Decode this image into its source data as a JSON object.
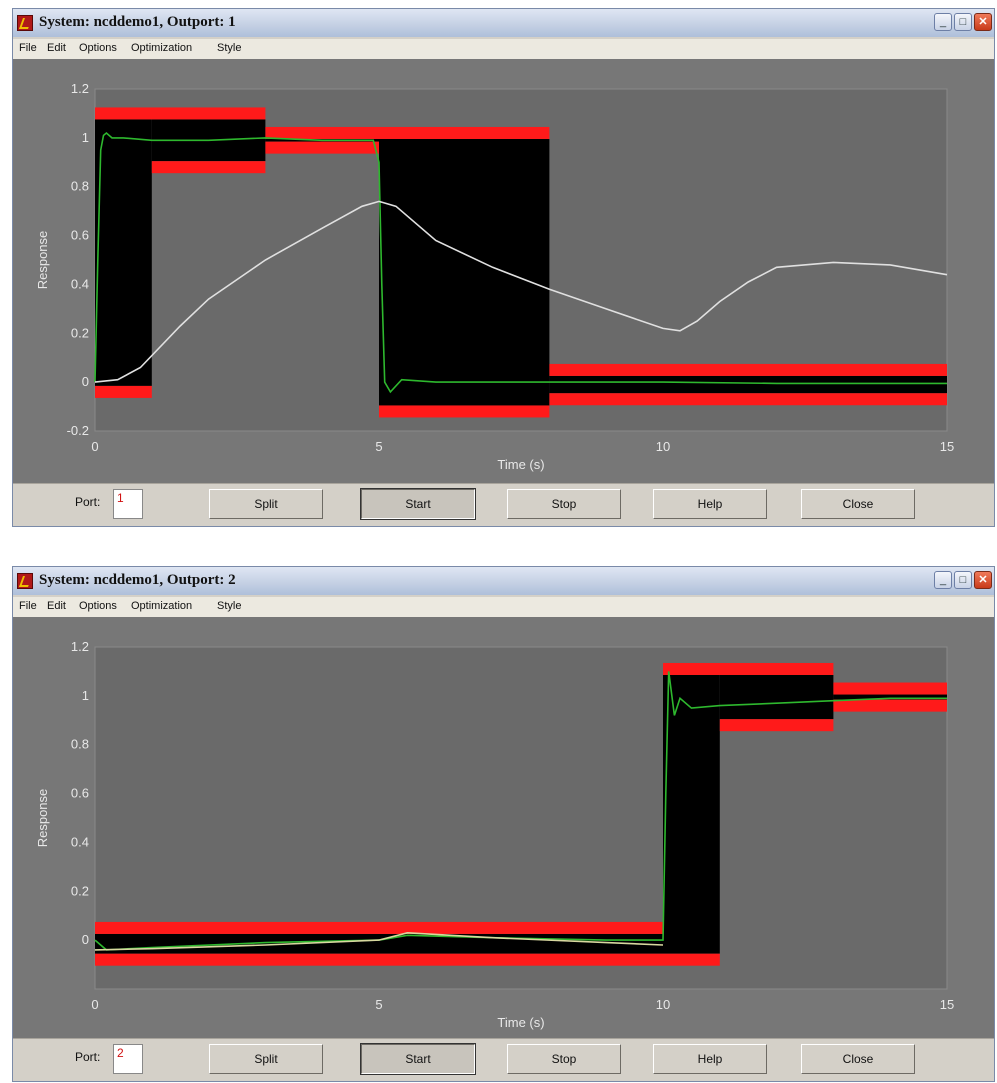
{
  "windows": [
    {
      "title": "System: ncddemo1, Outport: 1",
      "menu": [
        "File",
        "Edit",
        "Options",
        "Optimization",
        "Style"
      ],
      "port_label": "Port:",
      "port_value": "1",
      "buttons": [
        "Split",
        "Start",
        "Stop",
        "Help",
        "Close"
      ],
      "chart_data": {
        "type": "line",
        "xlabel": "Time (s)",
        "ylabel": "Response",
        "xlim": [
          0,
          15
        ],
        "ylim": [
          -0.2,
          1.2
        ],
        "xticks": [
          "0",
          "5",
          "10",
          "15"
        ],
        "yticks": [
          "-0.2",
          "0",
          "0.2",
          "0.4",
          "0.6",
          "0.8",
          "1",
          "1.2"
        ],
        "upper_constraints": [
          {
            "x": [
              0,
              3
            ],
            "y": 1.1
          },
          {
            "x": [
              3,
              8
            ],
            "y": 1.02
          }
        ],
        "lower_constraints": [
          {
            "x": [
              0,
              1
            ],
            "y": -0.04
          },
          {
            "x": [
              1,
              3
            ],
            "y": 0.88
          },
          {
            "x": [
              3,
              5
            ],
            "y": 0.96
          },
          {
            "x": [
              5,
              8
            ],
            "y": -0.12
          }
        ],
        "band_constraints": [
          {
            "x": [
              8,
              15
            ],
            "upper": 0.05,
            "lower": -0.07
          }
        ],
        "series": [
          {
            "color": "#2eb82e",
            "x": [
              0,
              0.05,
              0.1,
              0.15,
              0.2,
              0.3,
              0.5,
              1,
              2,
              3,
              4,
              4.9,
              5,
              5.05,
              5.1,
              5.2,
              5.4,
              6,
              8,
              10,
              12,
              15
            ],
            "y": [
              0,
              0.5,
              0.95,
              1.01,
              1.02,
              1.0,
              1.0,
              0.99,
              0.99,
              1.0,
              0.99,
              0.99,
              0.9,
              0.4,
              0.0,
              -0.04,
              0.01,
              0.0,
              0.0,
              0.0,
              -0.005,
              -0.005
            ]
          },
          {
            "color": "#e0e0e0",
            "x": [
              0,
              0.4,
              0.8,
              1.5,
              2,
              3,
              4,
              4.7,
              5,
              5.3,
              6,
              7,
              8,
              9,
              10,
              10.3,
              10.6,
              11,
              11.5,
              12,
              13,
              14,
              15
            ],
            "y": [
              0,
              0.01,
              0.06,
              0.23,
              0.34,
              0.5,
              0.63,
              0.72,
              0.74,
              0.72,
              0.58,
              0.47,
              0.38,
              0.3,
              0.22,
              0.21,
              0.25,
              0.33,
              0.41,
              0.47,
              0.49,
              0.48,
              0.44
            ]
          }
        ]
      }
    },
    {
      "title": "System: ncddemo1, Outport: 2",
      "menu": [
        "File",
        "Edit",
        "Options",
        "Optimization",
        "Style"
      ],
      "port_label": "Port:",
      "port_value": "2",
      "buttons": [
        "Split",
        "Start",
        "Stop",
        "Help",
        "Close"
      ],
      "chart_data": {
        "type": "line",
        "xlabel": "Time (s)",
        "ylabel": "Response",
        "xlim": [
          0,
          15
        ],
        "ylim": [
          -0.2,
          1.2
        ],
        "xticks": [
          "0",
          "5",
          "10",
          "15"
        ],
        "yticks": [
          "0",
          "0.2",
          "0.4",
          "0.6",
          "0.8",
          "1",
          "1.2"
        ],
        "upper_constraints": [
          {
            "x": [
              0,
              10
            ],
            "y": 0.05
          },
          {
            "x": [
              10,
              13
            ],
            "y": 1.11
          },
          {
            "x": [
              13,
              15
            ],
            "y": 1.03
          }
        ],
        "lower_constraints": [
          {
            "x": [
              0,
              11
            ],
            "y": -0.08
          },
          {
            "x": [
              11,
              13
            ],
            "y": 0.88
          },
          {
            "x": [
              13,
              15
            ],
            "y": 0.96
          }
        ],
        "band_constraints": [],
        "series": [
          {
            "color": "#2eb82e",
            "x": [
              0,
              0.2,
              1,
              3,
              5,
              5.5,
              7,
              9,
              10,
              10.05,
              10.1,
              10.2,
              10.3,
              10.5,
              11,
              12,
              13,
              14,
              15
            ],
            "y": [
              0,
              -0.04,
              -0.03,
              -0.01,
              0.0,
              0.02,
              0.01,
              0.0,
              0.0,
              0.6,
              1.1,
              0.92,
              0.99,
              0.95,
              0.96,
              0.97,
              0.98,
              0.99,
              0.99
            ]
          },
          {
            "color": "#d8d8a0",
            "x": [
              0,
              1,
              3,
              5,
              5.5,
              7,
              9,
              10
            ],
            "y": [
              -0.04,
              -0.035,
              -0.02,
              0.0,
              0.03,
              0.01,
              -0.01,
              -0.02
            ]
          }
        ]
      }
    }
  ]
}
